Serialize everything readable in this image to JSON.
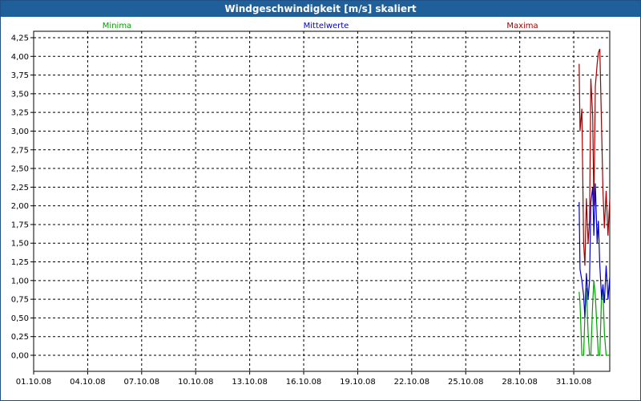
{
  "window": {
    "title": "Windgeschwindigkeit [m/s] skaliert"
  },
  "chart_data": {
    "type": "line",
    "title": "Windgeschwindigkeit [m/s] skaliert",
    "xlabel": "",
    "ylabel": "",
    "ylim": [
      0,
      4.25
    ],
    "yticks": [
      "0,00",
      "0,25",
      "0,50",
      "0,75",
      "1,00",
      "1,25",
      "1,50",
      "1,75",
      "2,00",
      "2,25",
      "2,50",
      "2,75",
      "3,00",
      "3,25",
      "3,50",
      "3,75",
      "4,00",
      "4,25"
    ],
    "xtick_labels": [
      "01.10.08",
      "04.10.08",
      "07.10.08",
      "10.10.08",
      "13.10.08",
      "16.10.08",
      "19.10.08",
      "22.10.08",
      "25.10.08",
      "28.10.08",
      "31.10.08"
    ],
    "xlim_days": [
      0,
      32
    ],
    "grid": true,
    "legend_position": "top",
    "series": [
      {
        "name": "Minima",
        "color": "#00a000",
        "x": [
          30.3,
          30.35,
          30.45,
          30.55,
          30.62,
          30.7,
          30.8,
          30.88,
          30.95,
          31.05,
          31.12,
          31.2,
          31.3,
          31.37,
          31.45,
          31.55,
          31.62,
          31.7,
          31.8,
          31.9,
          32.0
        ],
        "y": [
          0.85,
          0.7,
          0.0,
          0.0,
          0.55,
          0.9,
          0.3,
          0.0,
          0.0,
          0.7,
          1.0,
          0.8,
          0.3,
          0.0,
          0.0,
          0.85,
          0.9,
          0.3,
          0.0,
          0.0,
          0.0
        ]
      },
      {
        "name": "Mittelwerte",
        "color": "#0000c8",
        "x": [
          30.3,
          30.35,
          30.45,
          30.55,
          30.62,
          30.7,
          30.8,
          30.88,
          30.95,
          31.05,
          31.12,
          31.2,
          31.3,
          31.37,
          31.45,
          31.55,
          31.62,
          31.7,
          31.8,
          31.9,
          32.0
        ],
        "y": [
          2.05,
          1.15,
          1.0,
          0.8,
          0.5,
          1.1,
          0.75,
          1.0,
          2.05,
          2.25,
          1.6,
          2.3,
          1.5,
          1.8,
          1.2,
          0.75,
          0.95,
          0.7,
          1.2,
          0.75,
          1.05
        ]
      },
      {
        "name": "Maxima",
        "color": "#a00000",
        "x": [
          30.3,
          30.35,
          30.45,
          30.55,
          30.62,
          30.7,
          30.8,
          30.88,
          30.95,
          31.05,
          31.12,
          31.2,
          31.3,
          31.37,
          31.45,
          31.55,
          31.62,
          31.7,
          31.8,
          31.9,
          32.0
        ],
        "y": [
          3.9,
          3.0,
          3.3,
          1.5,
          1.2,
          2.1,
          1.5,
          1.8,
          3.7,
          3.2,
          2.0,
          3.6,
          3.9,
          4.05,
          4.1,
          3.0,
          2.2,
          1.7,
          2.2,
          1.6,
          2.1
        ]
      }
    ]
  }
}
